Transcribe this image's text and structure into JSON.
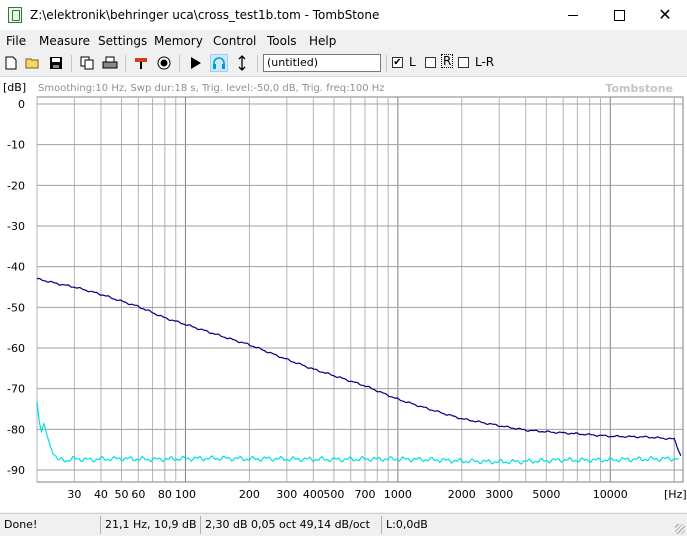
{
  "window": {
    "title": "Z:\\elektronik\\behringer uca\\cross_test1b.tom - TombStone"
  },
  "menu": [
    "File",
    "Measure",
    "Settings",
    "Memory",
    "Control",
    "Tools",
    "Help"
  ],
  "toolbar": {
    "buttons": [
      "new-icon",
      "open-icon",
      "save-icon",
      "copy-icon",
      "print-icon",
      "probe-icon",
      "record-icon",
      "play-icon",
      "headphones-icon",
      "marker-icon"
    ],
    "combo_value": "(untitled)",
    "check_l_label": "L",
    "check_r_label": "R",
    "check_lr_label": "L-R",
    "check_l_checked": "✔"
  },
  "graph": {
    "unit_label": "[dB]",
    "info": "Smoothing:10 Hz, Swp dur:18 s, Trig. level:-50,0 dB, Trig. freq:100 Hz",
    "watermark": "Tombstone",
    "x_unit": "[Hz]"
  },
  "chart_data": {
    "type": "line",
    "xscale": "log",
    "ylim": [
      -92,
      2
    ],
    "xlim": [
      20,
      22000
    ],
    "y_ticks": [
      0,
      -10,
      -20,
      -30,
      -40,
      -50,
      -60,
      -70,
      -80,
      -90
    ],
    "y_tick_labels": [
      "0",
      "-10",
      "-20",
      "-30",
      "-40",
      "-50",
      "-60",
      "-70",
      "-80",
      "-90"
    ],
    "x_tick_labels": [
      {
        "v": 30,
        "t": "30"
      },
      {
        "v": 40,
        "t": "40"
      },
      {
        "v": 50,
        "t": "50"
      },
      {
        "v": 60,
        "t": "60"
      },
      {
        "v": 80,
        "t": "80"
      },
      {
        "v": 100,
        "t": "100"
      },
      {
        "v": 200,
        "t": "200"
      },
      {
        "v": 300,
        "t": "300"
      },
      {
        "v": 400,
        "t": "400"
      },
      {
        "v": 500,
        "t": "500"
      },
      {
        "v": 700,
        "t": "700"
      },
      {
        "v": 1000,
        "t": "1000"
      },
      {
        "v": 2000,
        "t": "2000"
      },
      {
        "v": 3000,
        "t": "3000"
      },
      {
        "v": 5000,
        "t": "5000"
      },
      {
        "v": 10000,
        "t": "10000"
      }
    ],
    "series": [
      {
        "color": "#000080",
        "x": [
          20,
          22,
          25,
          30,
          40,
          50,
          60,
          80,
          100,
          150,
          200,
          300,
          400,
          500,
          700,
          1000,
          1500,
          2000,
          3000,
          4000,
          5000,
          7000,
          10000,
          15000,
          20000,
          21500
        ],
        "y": [
          -43,
          -43.5,
          -44.2,
          -45,
          -46.8,
          -48.5,
          -49.8,
          -52.6,
          -54.2,
          -57.2,
          -59.2,
          -62.8,
          -65.2,
          -66.8,
          -69.3,
          -72.6,
          -75.5,
          -77.4,
          -79.1,
          -80.2,
          -80.6,
          -81.1,
          -81.7,
          -81.9,
          -82.4,
          -86.5
        ]
      },
      {
        "color": "#00e0e0",
        "x": [
          20,
          20.5,
          21,
          21.5,
          22,
          23,
          25,
          28,
          30,
          35,
          40,
          50,
          70,
          100,
          150,
          200,
          250,
          300,
          500,
          700,
          1000,
          1500,
          2000,
          3000,
          4000,
          5000,
          6000,
          7000,
          10000,
          15000,
          21000
        ],
        "y": [
          -73,
          -78,
          -80,
          -79,
          -80.5,
          -84,
          -87.5,
          -87.6,
          -87.2,
          -87.5,
          -87.3,
          -87.2,
          -87.4,
          -87.2,
          -87.1,
          -87.3,
          -87.2,
          -87.3,
          -87.4,
          -87.3,
          -87.3,
          -87.5,
          -87.8,
          -88.0,
          -87.9,
          -87.7,
          -87.5,
          -87.6,
          -87.5,
          -87.3,
          -87.2
        ]
      }
    ]
  },
  "status": {
    "state": "Done!",
    "cursor": "21,1 Hz, 10,9 dB",
    "slope": "2,30 dB 0,05 oct 49,14 dB/oct",
    "level": "L:0,0dB"
  }
}
